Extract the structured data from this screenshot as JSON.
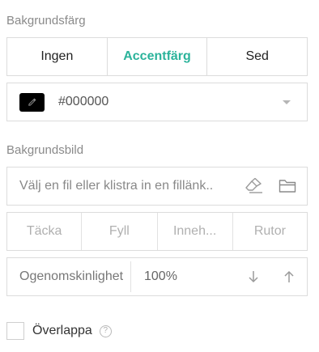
{
  "background_color": {
    "label": "Bakgrundsfärg",
    "options": [
      "Ingen",
      "Accentfärg",
      "Sed"
    ],
    "active_option": "Accentfärg",
    "accent_color": "#2bb39b",
    "swatch_color": "#000000",
    "hex_value": "#000000"
  },
  "background_image": {
    "label": "Bakgrundsbild",
    "file_placeholder": "Välj en fil eller klistra in en fillänk..",
    "fit_options": [
      "Täcka",
      "Fyll",
      "Inneh...",
      "Rutor"
    ],
    "opacity_label": "Ogenomskinlighet",
    "opacity_value": "100%"
  },
  "overlap": {
    "label": "Överlappa",
    "checked": false,
    "help_glyph": "?"
  }
}
